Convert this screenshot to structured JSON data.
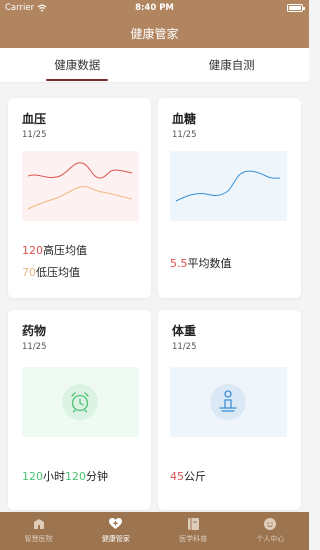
{
  "status_bar": {
    "carrier": "Carrier",
    "time": "8:40 PM"
  },
  "nav": {
    "title": "健康管家"
  },
  "tabs": [
    {
      "label": "健康数据",
      "active": true
    },
    {
      "label": "健康自测",
      "active": false
    }
  ],
  "cards": {
    "blood_pressure": {
      "title": "血压",
      "date": "11/25",
      "high_value": "120",
      "high_label": "高压均值",
      "low_value": "70",
      "low_label": "低压均值"
    },
    "blood_sugar": {
      "title": "血糖",
      "date": "11/25",
      "value": "5.5",
      "label": "平均数值"
    },
    "medicine": {
      "title": "药物",
      "date": "11/25",
      "hours": "120",
      "hours_unit": "小时",
      "minutes": "120",
      "minutes_unit": "分钟"
    },
    "weight": {
      "title": "体重",
      "date": "11/25",
      "value": "45",
      "unit": "公斤"
    }
  },
  "bottom_nav": [
    {
      "label": "智慧医院",
      "icon": "hospital-icon",
      "active": false
    },
    {
      "label": "健康管家",
      "icon": "heart-plus-icon",
      "active": true
    },
    {
      "label": "医学科普",
      "icon": "book-icon",
      "active": false
    },
    {
      "label": "个人中心",
      "icon": "user-face-icon",
      "active": false
    }
  ],
  "colors": {
    "header": "#b08560",
    "bottom_bar": "#9c7450",
    "tab_indicator": "#7a2a2a",
    "high_pressure": "#d9534f",
    "low_pressure": "#f0b67f",
    "medicine_accent": "#4cc474",
    "sugar_line": "#3a8fd4",
    "weight_accent": "#3a8fd4"
  }
}
